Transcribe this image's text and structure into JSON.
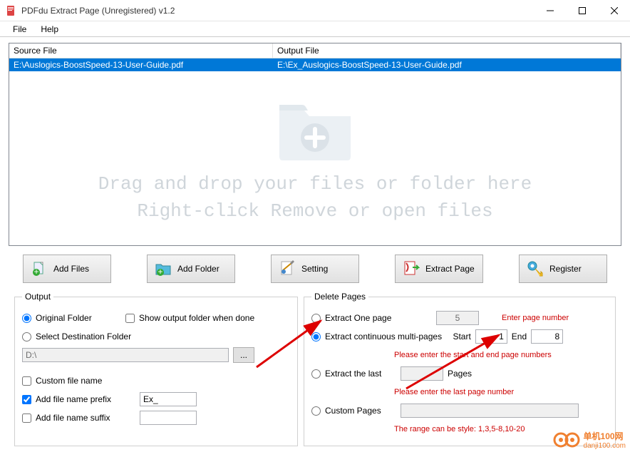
{
  "window": {
    "title": "PDFdu Extract Page (Unregistered) v1.2"
  },
  "menu": {
    "file": "File",
    "help": "Help"
  },
  "table": {
    "col_source": "Source File",
    "col_output": "Output File",
    "row_source": "E:\\Auslogics-BoostSpeed-13-User-Guide.pdf",
    "row_output": "E:\\Ex_Auslogics-BoostSpeed-13-User-Guide.pdf"
  },
  "dropzone": {
    "line1": "Drag and drop your files or folder here",
    "line2": "Right-click Remove or open files"
  },
  "toolbar": {
    "add_files": "Add Files",
    "add_folder": "Add Folder",
    "setting": "Setting",
    "extract": "Extract Page",
    "register": "Register"
  },
  "output": {
    "legend": "Output",
    "original_folder": "Original Folder",
    "show_when_done": "Show output folder when done",
    "select_dest": "Select Destination Folder",
    "dest_path": "D:\\",
    "custom_name": "Custom file name",
    "prefix_label": "Add file name prefix",
    "prefix_value": "Ex_",
    "suffix_label": "Add file name suffix"
  },
  "delete": {
    "legend": "Delete Pages",
    "extract_one": "Extract One page",
    "one_value": "5",
    "one_hint": "Enter page number",
    "extract_multi": "Extract continuous multi-pages",
    "start_label": "Start",
    "start_value": "1",
    "end_label": "End",
    "end_value": "8",
    "multi_hint": "Please enter the start and end page numbers",
    "extract_last": "Extract the last",
    "last_unit": "Pages",
    "last_hint": "Please enter the last page number",
    "custom": "Custom Pages",
    "custom_hint": "The range can be style:  1,3,5-8,10-20"
  },
  "watermark": {
    "site": "单机100网",
    "url": "danji100.com"
  }
}
